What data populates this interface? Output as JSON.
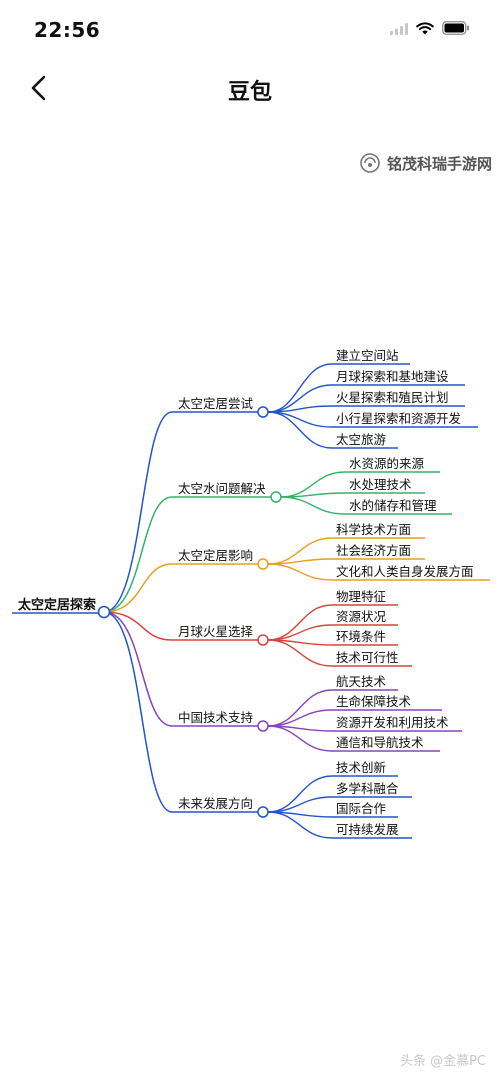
{
  "status_bar": {
    "time": "22:56",
    "battery": "battery-icon",
    "wifi": "wifi-icon",
    "signal": "signal-icon"
  },
  "nav": {
    "title": "豆包",
    "back_icon": "chevron-left-icon"
  },
  "watermark_top": "铭茂科瑞手游网",
  "watermark_bottom": "头条 @金慕PC",
  "mindmap": {
    "root": "太空定居探索",
    "branches": [
      {
        "label": "太空定居尝试",
        "color": "#2255cc",
        "children": [
          "建立空间站",
          "月球探索和基地建设",
          "火星探索和殖民计划",
          "小行星探索和资源开发",
          "太空旅游"
        ]
      },
      {
        "label": "太空水问题解决",
        "color": "#33b366",
        "children": [
          "水资源的来源",
          "水处理技术",
          "水的储存和管理"
        ]
      },
      {
        "label": "太空定居影响",
        "color": "#e8a020",
        "children": [
          "科学技术方面",
          "社会经济方面",
          "文化和人类自身发展方面"
        ]
      },
      {
        "label": "月球火星选择",
        "color": "#d9433b",
        "children": [
          "物理特征",
          "资源状况",
          "环境条件",
          "技术可行性"
        ]
      },
      {
        "label": "中国技术支持",
        "color": "#8844bb",
        "children": [
          "航天技术",
          "生命保障技术",
          "资源开发和利用技术",
          "通信和导航技术"
        ]
      },
      {
        "label": "未来发展方向",
        "color": "#2255cc",
        "children": [
          "技术创新",
          "多学科融合",
          "国际合作",
          "可持续发展"
        ]
      }
    ]
  }
}
